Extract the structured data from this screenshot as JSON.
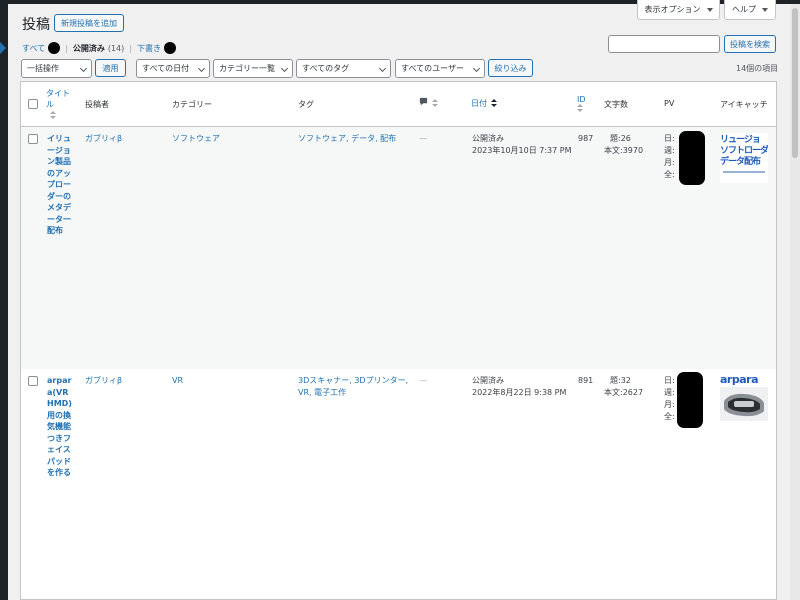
{
  "header": {
    "title": "投稿",
    "add_new": "新規投稿を追加",
    "screen_options": "表示オプション",
    "help": "ヘルプ"
  },
  "views": {
    "all": "すべて",
    "published": "公開済み",
    "published_count": "(14)",
    "drafts": "下書き"
  },
  "search": {
    "placeholder": "",
    "button": "投稿を検索"
  },
  "filters": {
    "bulk_action": "一括操作",
    "apply": "適用",
    "dates": "すべての日付",
    "categories": "カテゴリー一覧",
    "tags": "すべてのタグ",
    "users": "すべてのユーザー",
    "filter_button": "絞り込み",
    "items_count": "14個の項目"
  },
  "columns": {
    "title": "タイトル",
    "author": "投稿者",
    "categories": "カテゴリー",
    "tags": "タグ",
    "date": "日付",
    "id": "ID",
    "word_count": "文字数",
    "pv": "PV",
    "eyecatch": "アイキャッチ"
  },
  "rows": [
    {
      "title": "イリュージョン製品のアップローダーのメタデータ一配布",
      "author": "ガブリィβ",
      "category": "ソフトウェア",
      "tags": "ソフトウェア, データ, 配布",
      "comments": "—",
      "status": "公開済み",
      "date": "2023年10月10日 7:37 PM",
      "id": "987",
      "words_title": "題:26",
      "words_body": "本文:3970",
      "pv_labels": [
        "日:",
        "週:",
        "月:",
        "全:"
      ],
      "thumb_lines": [
        "リュージョ",
        "ソフトローダ",
        "データ配布"
      ]
    },
    {
      "title": "arpara(VR HMD)用の換気機能つきフェイスパッドを作る",
      "author": "ガブリィβ",
      "category": "VR",
      "tags": "3Dスキャナー, 3Dプリンター, VR, 電子工作",
      "comments": "—",
      "status": "公開済み",
      "date": "2022年8月22日 9:38 PM",
      "id": "891",
      "words_title": "題:32",
      "words_body": "本文:2627",
      "pv_labels": [
        "日:",
        "週:",
        "月:",
        "全:"
      ],
      "thumb_lines": [
        "arpara"
      ]
    }
  ],
  "colors": {
    "accent": "#2271b1",
    "admin_bar": "#1d2327"
  }
}
